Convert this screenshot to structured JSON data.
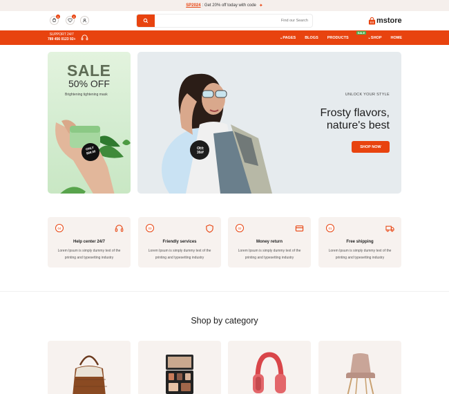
{
  "announcement": {
    "code": "SP2024",
    "text": ": Get 20% off today with code"
  },
  "header": {
    "cart_count": "0",
    "wishlist_count": "0",
    "search_placeholder": "Find our Search",
    "logo_text": "mstore"
  },
  "nav": {
    "support_line1": "SUPPORT 24/7",
    "support_line2": "789 456 0123 92+",
    "links": [
      {
        "label": "PAGES",
        "has_chevron": true
      },
      {
        "label": "BLOGS"
      },
      {
        "label": "PRODUCTS"
      },
      {
        "label": "SHOP",
        "has_chevron": true,
        "tag": "SALE"
      },
      {
        "label": "HOME"
      }
    ]
  },
  "promo": {
    "sale": "SALE",
    "off": "50% OFF",
    "sub": "Brightening tightening mask",
    "badge_line1": "ONLY",
    "badge_line2": "$99.00"
  },
  "hero": {
    "kicker": "UNLOCK YOUR STYLE",
    "title_line1": "Frosty flavors,",
    "title_line2": "nature's best",
    "cta": "SHOP NOW",
    "badge_line1": "30%",
    "badge_line2": "OFF"
  },
  "features": [
    {
      "num": "04",
      "icon": "headset-icon",
      "title": "Help center 24/7",
      "desc": "Lorem Ipsum is simply dummy text of the printing and typesetting industry"
    },
    {
      "num": "03",
      "icon": "shield-icon",
      "title": "Friendly services",
      "desc": "Lorem Ipsum is simply dummy text of the printing and typesetting industry"
    },
    {
      "num": "02",
      "icon": "card-icon",
      "title": "Money return",
      "desc": "Lorem Ipsum is simply dummy text of the printing and typesetting industry"
    },
    {
      "num": "01",
      "icon": "truck-icon",
      "title": "Free shipping",
      "desc": "Lorem Ipsum is simply dummy text of the printing and typesetting industry"
    }
  ],
  "category_title": "Shop by category",
  "categories": [
    {
      "icon": "handbag-icon"
    },
    {
      "icon": "palette-icon"
    },
    {
      "icon": "headphones-icon"
    },
    {
      "icon": "chair-icon"
    }
  ],
  "colors": {
    "accent": "#e8430f",
    "card_bg": "#f7f2ef"
  }
}
